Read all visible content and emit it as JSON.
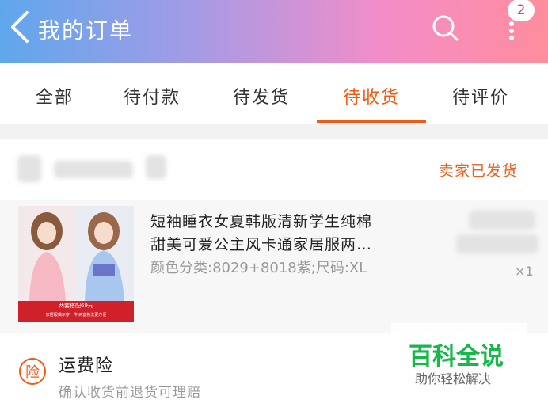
{
  "header": {
    "title": "我的订单",
    "badge_count": "2"
  },
  "tabs": [
    {
      "label": "全部"
    },
    {
      "label": "待付款"
    },
    {
      "label": "待发货"
    },
    {
      "label": "待收货",
      "active": true
    },
    {
      "label": "待评价"
    }
  ],
  "order": {
    "status": "卖家已发货",
    "product": {
      "title_line1": "短袖睡衣女夏韩版清新学生纯棉",
      "title_line2": "甜美可爱公主风卡通家居服两…",
      "sku": "颜色分类:8029+8018紫;尺码:XL",
      "quantity": "×1",
      "image_caption1": "两套搭配69元",
      "image_caption2": "家居服偶尔穿一件 两套换洗更方便"
    }
  },
  "insurance": {
    "icon_char": "险",
    "title": "运费险",
    "description": "确认收货前退货可理赔"
  },
  "watermark": {
    "main": "百科全说",
    "sub": "助你轻松解决"
  },
  "colors": {
    "accent": "#f05a14",
    "watermark_green": "#16b84a"
  }
}
